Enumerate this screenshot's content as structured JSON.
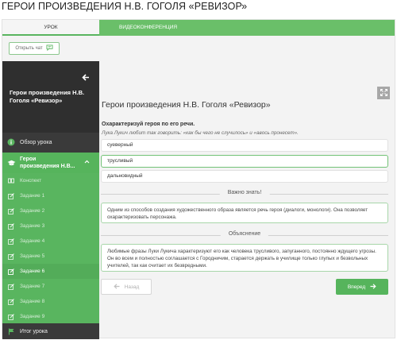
{
  "page": {
    "title": "ГЕРОИ ПРОИЗВЕДЕНИЯ Н.В. ГОГОЛЯ «РЕВИЗОР»"
  },
  "tabs": {
    "lesson": "УРОК",
    "video": "ВИДЕОКОНФЕРЕНЦИЯ"
  },
  "chat_button": {
    "label": "Открыть чат"
  },
  "sidebar": {
    "lesson_title": "Герои произведения Н.В. Гоголя «Ревизор»",
    "overview": "Обзор урока",
    "active_topic_line1": "Герои",
    "active_topic_line2": "произведения Н.В...",
    "items": [
      {
        "label": "Конспект"
      },
      {
        "label": "Задание 1"
      },
      {
        "label": "Задание 2"
      },
      {
        "label": "Задание 3"
      },
      {
        "label": "Задание 4"
      },
      {
        "label": "Задание 5"
      },
      {
        "label": "Задание 6"
      },
      {
        "label": "Задание 7"
      },
      {
        "label": "Задание 8"
      },
      {
        "label": "Задание 9"
      }
    ],
    "current_item": "Задание 6",
    "final": "Итог урока"
  },
  "main": {
    "title": "Герои произведения Н.В. Гоголя «Ревизор»",
    "question": "Охарактеризуй героя по его речи.",
    "hint": "Лука Лукич любит так говорить: «как бы чего не случилось» и «авось пронесет».",
    "options": [
      "суеверный",
      "трусливый",
      "дальновидный"
    ],
    "selected_option": "трусливый",
    "important_heading": "Важно знать!",
    "important_text": "Одним из способов создания художественного образа является речь героя (диалоги, монологи). Она позволяет охарактеризовать персонажа.",
    "explanation_heading": "Объяснение",
    "explanation_text": "Любимые фразы Луки Лукича характеризуют его как человека трусливого, запуганного, постоянно ждущего угрозы. Он во всем и полностью соглашается с Городничим, старается держать в училище только глупых и безвольных учителей, так как считает их безвредными.",
    "back_label": "Назад",
    "next_label": "Вперед"
  },
  "colors": {
    "accent": "#56b45c",
    "sidebar_bg": "#3a3a3a",
    "sidebar_header_bg": "#2f2f2f",
    "expand_btn": "#a7a7a7"
  }
}
